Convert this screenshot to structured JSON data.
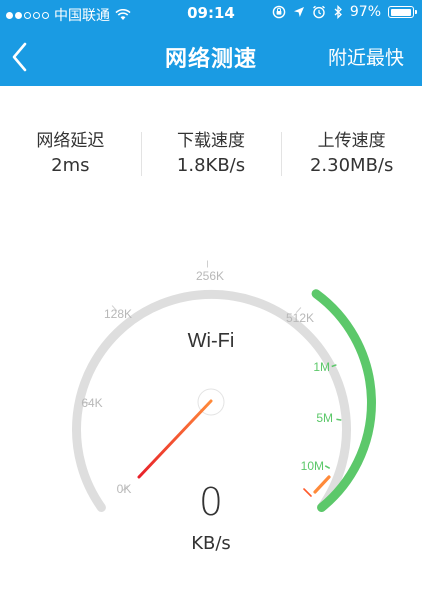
{
  "status_bar": {
    "carrier": "中国联通",
    "time": "09:14",
    "battery": "97%",
    "battery_level": 0.97,
    "icons": [
      "signal-dots-icon",
      "wifi-icon",
      "orientation-lock-icon",
      "location-arrow-icon",
      "alarm-icon",
      "bluetooth-icon",
      "battery-icon"
    ]
  },
  "nav": {
    "back_icon": "chevron-left-icon",
    "title": "网络测速",
    "right_action": "附近最快"
  },
  "stats": {
    "latency": {
      "label": "网络延迟",
      "value": "2ms"
    },
    "download": {
      "label": "下载速度",
      "value": "1.8KB/s"
    },
    "upload": {
      "label": "上传速度",
      "value": "2.30MB/s"
    }
  },
  "gauge": {
    "network_type": "Wi-Fi",
    "ticks": [
      "0K",
      "64K",
      "128K",
      "256K",
      "512K",
      "1M",
      "5M",
      "10M"
    ],
    "speed_value": "0",
    "speed_unit": "KB/s",
    "colors": {
      "track": "#dedede",
      "active": "#5cc86a",
      "needle": "#ff5a2b",
      "header": "#1a9be3"
    }
  }
}
